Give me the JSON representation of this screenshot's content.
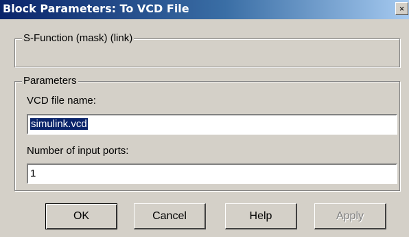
{
  "window": {
    "title": "Block Parameters: To VCD File",
    "close_glyph": "×"
  },
  "sfunction_group": {
    "legend": "S-Function (mask) (link)"
  },
  "parameters_group": {
    "legend": "Parameters",
    "vcd_label": "VCD file name:",
    "vcd_value": "simulink.vcd",
    "ports_label": "Number of input ports:",
    "ports_value": "1"
  },
  "buttons": {
    "ok": "OK",
    "cancel": "Cancel",
    "help": "Help",
    "apply": "Apply"
  }
}
